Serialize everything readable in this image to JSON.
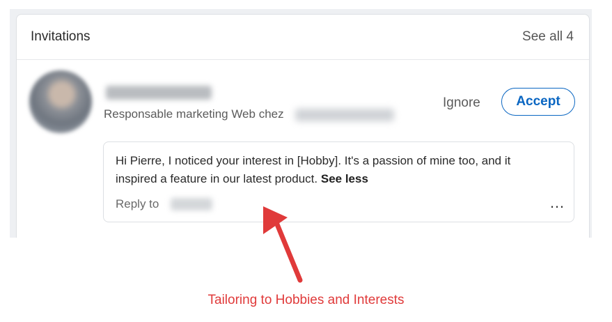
{
  "invitations": {
    "title": "Invitations",
    "see_all": "See all 4",
    "invite": {
      "headline": "Responsable marketing Web chez",
      "ignore_label": "Ignore",
      "accept_label": "Accept",
      "message": {
        "text": "Hi Pierre, I noticed your interest in [Hobby]. It's a passion of mine too, and it inspired a feature in our latest product.",
        "see_less": "See less",
        "reply_label": "Reply to",
        "more_icon": "…"
      }
    }
  },
  "annotation": {
    "caption": "Tailoring to Hobbies and Interests",
    "color": "#e03a3a"
  },
  "colors": {
    "accent": "#0a66c2"
  }
}
